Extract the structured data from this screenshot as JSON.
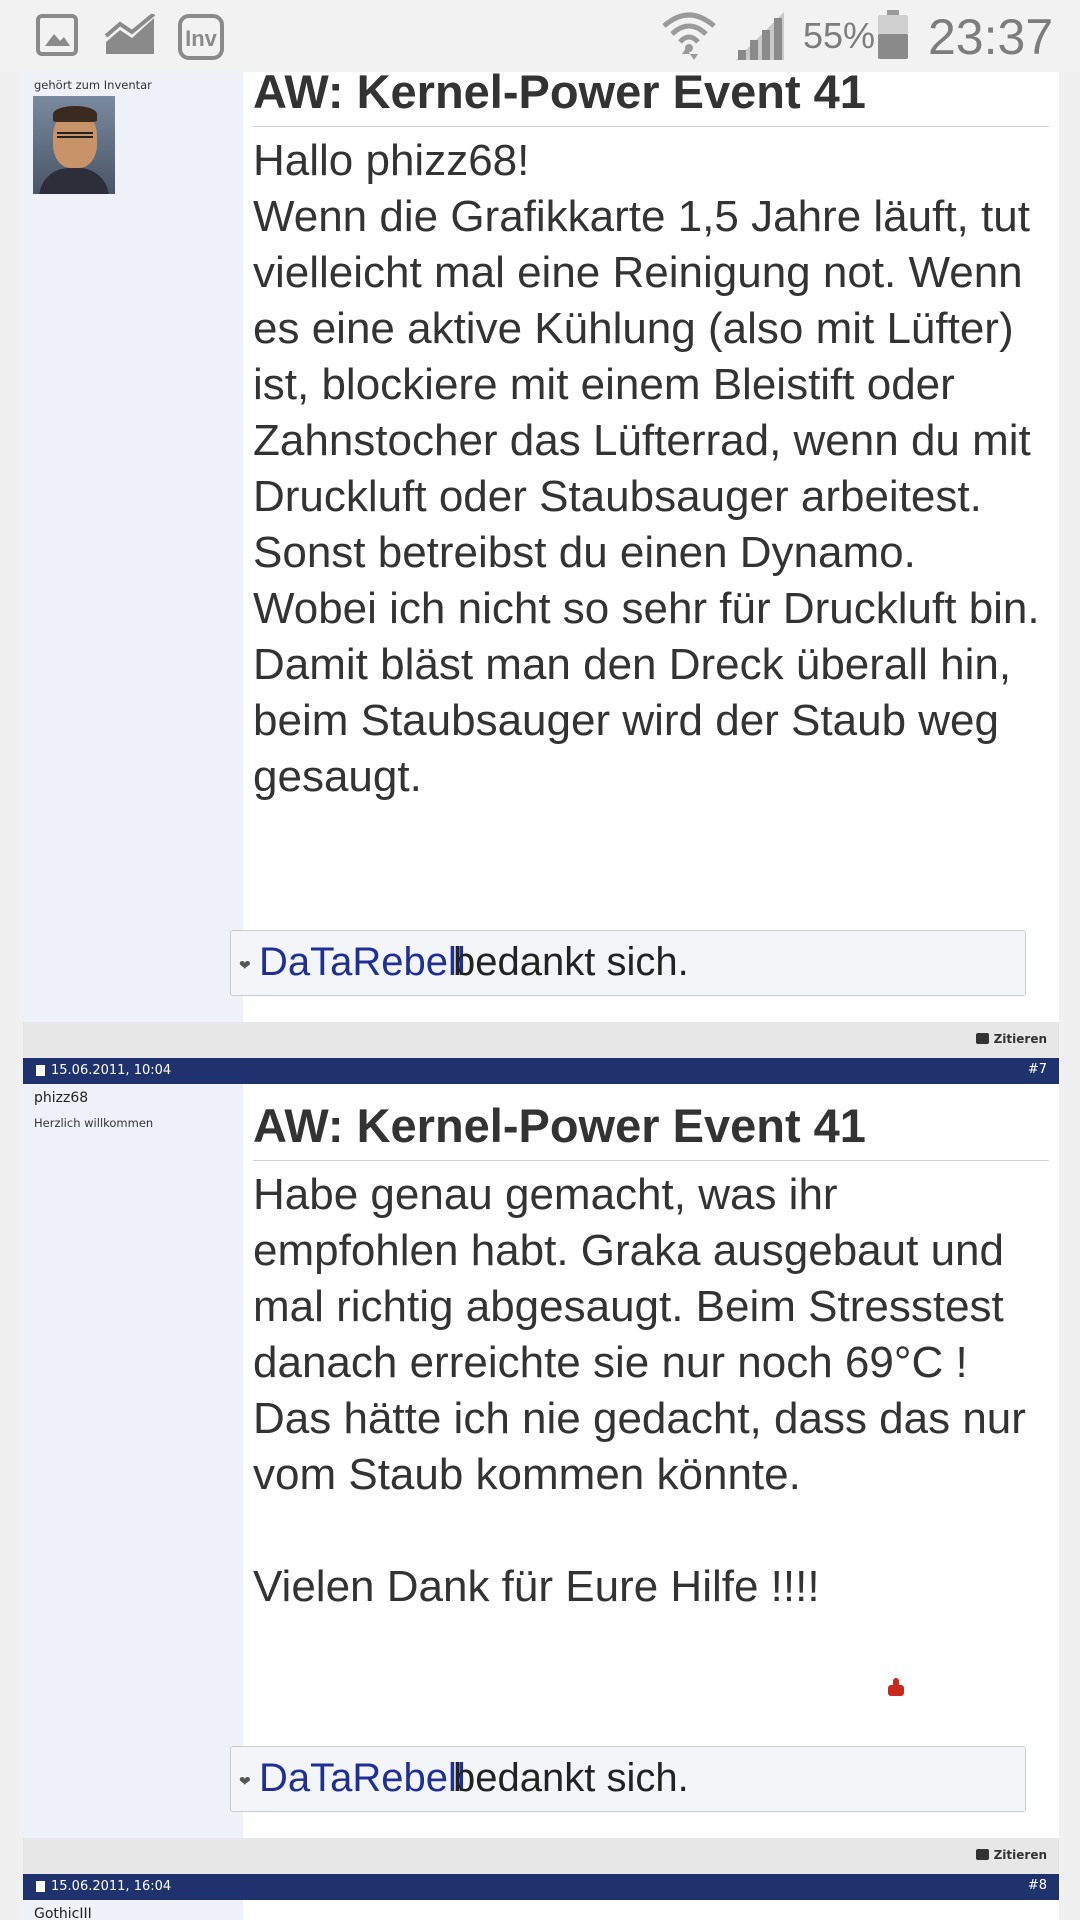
{
  "status_bar": {
    "battery": "55%",
    "time": "23:37"
  },
  "posts": [
    {
      "user_rank": "gehört zum Inventar",
      "title": "AW: Kernel-Power Event 41",
      "body": "Hallo phizz68!\nWenn die Grafikkarte 1,5 Jahre läuft, tut vielleicht mal eine Reinigung not. Wenn es eine aktive Kühlung (also mit Lüfter) ist, blockiere mit einem Bleistift oder Zahnstocher das Lüfterrad, wenn du mit Druckluft oder Staubsauger arbeitest. Sonst betreibst du einen Dynamo.\nWobei ich nicht so sehr für Druckluft bin. Damit bläst man den Dreck überall hin, beim Staubsauger wird der Staub weg gesaugt.",
      "thanks_user": "DaTaRebell",
      "thanks_text": "bedankt sich.",
      "quote_label": "Zitieren"
    },
    {
      "date": "15.06.2011, 10:04",
      "number": "#7",
      "user_name": "phizz68",
      "user_rank": "Herzlich willkommen",
      "title": "AW: Kernel-Power Event 41",
      "body": "Habe genau gemacht, was ihr empfohlen habt. Graka ausgebaut und mal richtig abgesaugt. Beim Stresstest danach erreichte sie nur noch 69°C ! Das hätte ich nie gedacht, dass das nur vom Staub kommen könnte.\n\nVielen Dank für Eure Hilfe !!!!",
      "thanks_user": "DaTaRebell",
      "thanks_text": "bedankt sich.",
      "quote_label": "Zitieren"
    },
    {
      "date": "15.06.2011, 16:04",
      "number": "#8",
      "user_name": "GothicIII"
    }
  ]
}
